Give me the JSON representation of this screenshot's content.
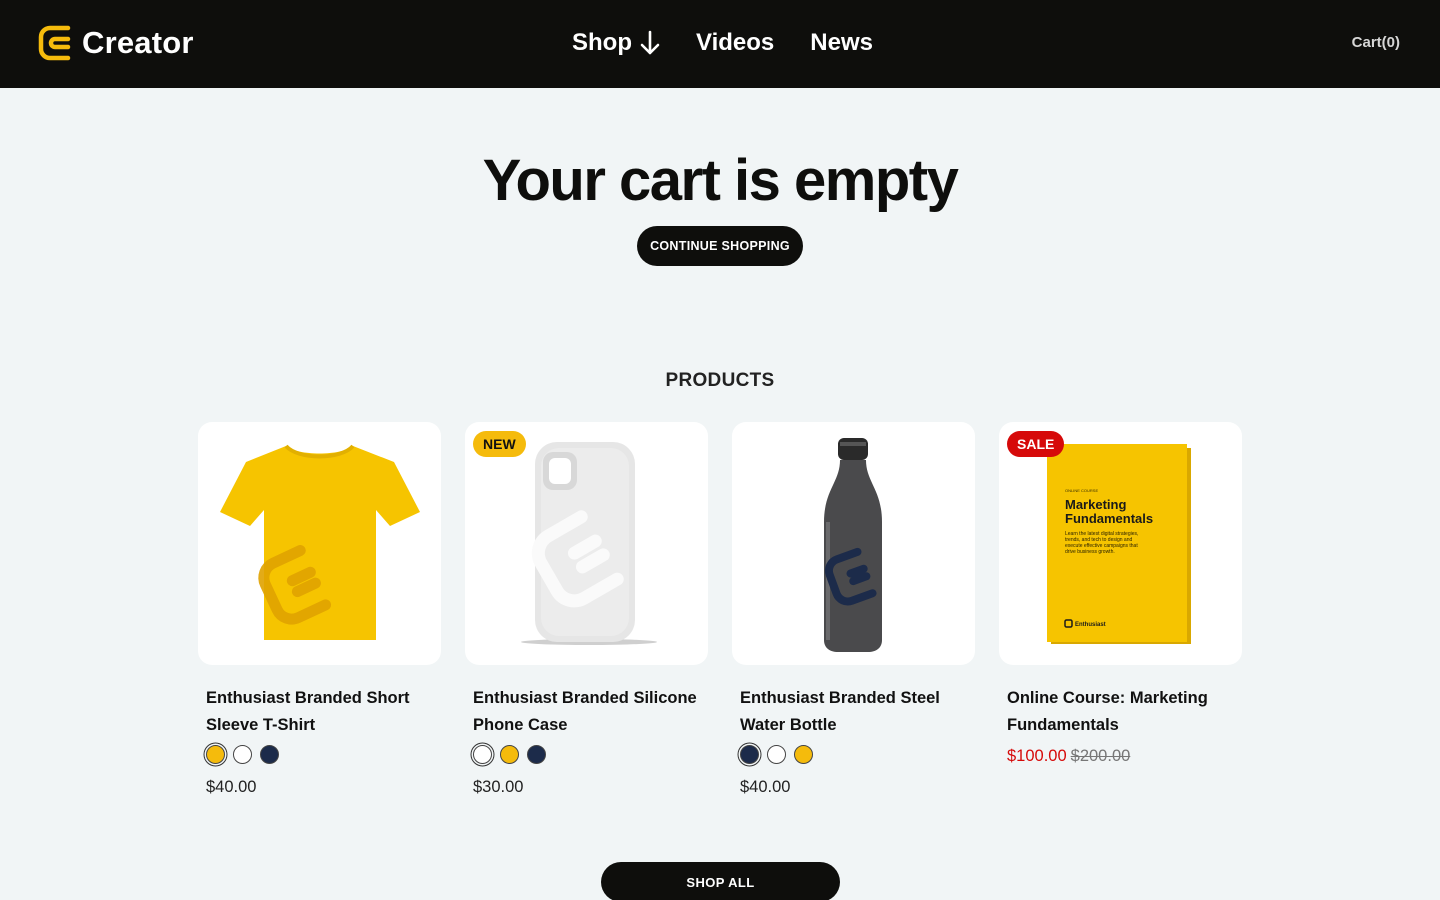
{
  "header": {
    "logo_text": "Creator",
    "nav": [
      {
        "label": "Shop",
        "icon": "arrow-down-icon"
      },
      {
        "label": "Videos"
      },
      {
        "label": "News"
      }
    ],
    "cart_label": "Cart(0)"
  },
  "cart": {
    "title": "Your cart is empty",
    "continue_label": "CONTINUE SHOPPING"
  },
  "products_section": {
    "title": "PRODUCTS",
    "items": [
      {
        "name": "Enthusiast Branded Short Sleeve T-Shirt",
        "badge": "",
        "swatches": [
          "#f5bb0c",
          "#ffffff",
          "#1c2b4a"
        ],
        "price": "$40.00"
      },
      {
        "name": "Enthusiast Branded Silicone Phone Case",
        "badge": "NEW",
        "swatches": [
          "#ffffff",
          "#f5bb0c",
          "#1c2b4a"
        ],
        "price": "$30.00"
      },
      {
        "name": "Enthusiast Branded Steel Water Bottle",
        "badge": "",
        "swatches": [
          "#1c2b4a",
          "#ffffff",
          "#f5bb0c"
        ],
        "price": "$40.00"
      },
      {
        "name": "Online Course: Marketing Fundamentals",
        "badge": "SALE",
        "sale_price": "$100.00",
        "original_price": "$200.00",
        "book": {
          "kicker": "ONLINE COURSE",
          "title_line1": "Marketing",
          "title_line2": "Fundamentals",
          "blurb": "Learn the latest digital strategies, trends, and tech to design and execute effective campaigns that drive business growth.",
          "brand": "Enthusiast"
        }
      }
    ],
    "shop_all_label": "SHOP ALL"
  },
  "colors": {
    "header_bg": "#0e0e0c",
    "brand_yellow": "#f5bb0c",
    "sale_red": "#d60a0a",
    "navy": "#1c2b4a",
    "page_bg": "#f1f5f6"
  }
}
